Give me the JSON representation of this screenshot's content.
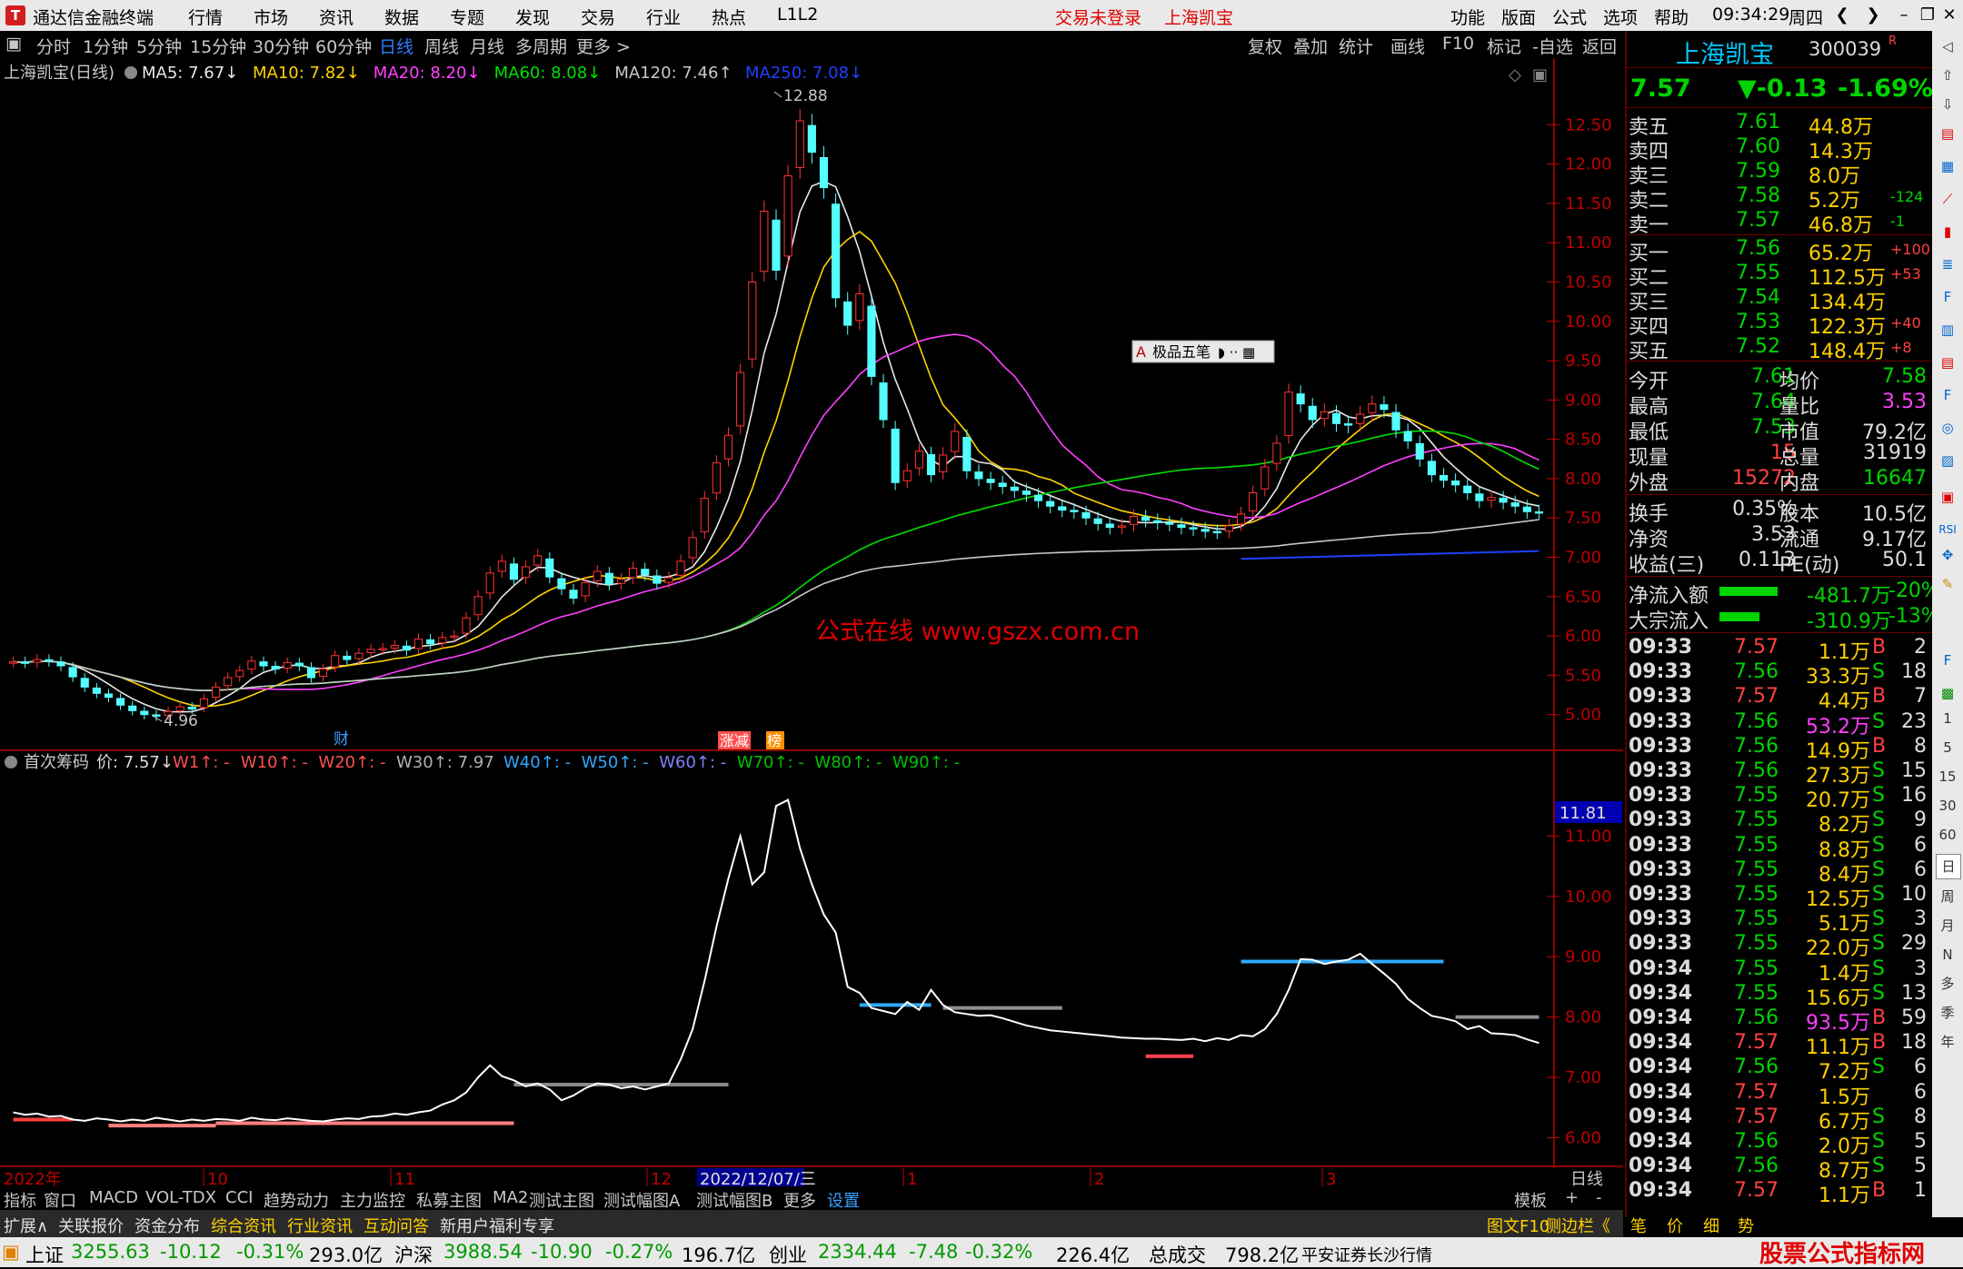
{
  "app": {
    "title": "通达信金融终端"
  },
  "menu": {
    "items": [
      "行情",
      "市场",
      "资讯",
      "数据",
      "专题",
      "发现",
      "交易",
      "行业",
      "热点",
      "L1L2"
    ],
    "trade_status": "交易未登录",
    "stock_name": "上海凯宝",
    "right_items": [
      "功能",
      "版面",
      "公式",
      "选项",
      "帮助"
    ],
    "time": "09:34:29",
    "weekday": "周四"
  },
  "periods": [
    "分时",
    "1分钟",
    "5分钟",
    "15分钟",
    "30分钟",
    "60分钟",
    "日线",
    "周线",
    "月线",
    "多周期",
    "更多 >"
  ],
  "tools": [
    "复权",
    "叠加",
    "统计",
    "画线",
    "F10",
    "标记",
    "-自选",
    "返回"
  ],
  "chart_header": {
    "title": "上海凯宝(日线)",
    "ma": [
      {
        "label": "MA5: 7.67↓",
        "color": "#e8e8e8"
      },
      {
        "label": "MA10: 7.82↓",
        "color": "#ffd400"
      },
      {
        "label": "MA20: 8.20↓",
        "color": "#ff40ff"
      },
      {
        "label": "MA60: 8.08↓",
        "color": "#00e000"
      },
      {
        "label": "MA120: 7.46↑",
        "color": "#c8c8c8"
      },
      {
        "label": "MA250: 7.08↓",
        "color": "#2040ff"
      }
    ]
  },
  "annotations": {
    "high": "12.88",
    "low": "4.96",
    "watermark": "公式在线  www.gszx.com.cn",
    "tag_cai": "财",
    "tag_zhangjian": "涨减",
    "tag_bang": "榜",
    "tool_popup": "极品五笔"
  },
  "sub_header": {
    "title": "首次筹码",
    "price": "价: 7.57↓",
    "items": [
      {
        "label": "W1↑: -",
        "color": "#ff5050"
      },
      {
        "label": "W10↑: -",
        "color": "#ff5050"
      },
      {
        "label": "W20↑: -",
        "color": "#ff5050"
      },
      {
        "label": "W30↑: 7.97",
        "color": "#b0b0b0"
      },
      {
        "label": "W40↑: -",
        "color": "#30a8ff"
      },
      {
        "label": "W50↑: -",
        "color": "#30a8ff"
      },
      {
        "label": "W60↑: -",
        "color": "#8080ff"
      },
      {
        "label": "W70↑: -",
        "color": "#00c000"
      },
      {
        "label": "W80↑: -",
        "color": "#00c000"
      },
      {
        "label": "W90↑: -",
        "color": "#00c000"
      }
    ],
    "current_marker": "11.81"
  },
  "x_axis": {
    "labels": [
      "2022年",
      "10",
      "11",
      "12",
      "2022/12/07/三",
      "1",
      "2",
      "3"
    ],
    "period": "日线"
  },
  "chart_data": {
    "type": "candlestick",
    "symbol": "300039",
    "ylim": [
      4.8,
      13.0
    ],
    "yticks": [
      5.0,
      5.5,
      6.0,
      6.5,
      7.0,
      7.5,
      8.0,
      8.5,
      9.0,
      9.5,
      10.0,
      10.5,
      11.0,
      11.5,
      12.0,
      12.5
    ],
    "closes": [
      5.67,
      5.66,
      5.7,
      5.68,
      5.62,
      5.48,
      5.35,
      5.27,
      5.22,
      5.12,
      5.05,
      5.0,
      4.98,
      5.04,
      5.1,
      5.07,
      5.2,
      5.35,
      5.47,
      5.56,
      5.68,
      5.62,
      5.58,
      5.66,
      5.62,
      5.47,
      5.58,
      5.75,
      5.7,
      5.78,
      5.83,
      5.84,
      5.88,
      5.82,
      5.96,
      5.9,
      5.98,
      6.0,
      6.23,
      6.5,
      6.8,
      6.95,
      6.72,
      6.88,
      7.02,
      6.75,
      6.6,
      6.48,
      6.68,
      6.82,
      6.66,
      6.72,
      6.86,
      6.78,
      6.67,
      6.74,
      6.95,
      7.25,
      7.75,
      8.2,
      8.55,
      9.35,
      10.5,
      11.4,
      10.65,
      11.85,
      12.55,
      12.15,
      11.7,
      10.3,
      9.95,
      10.35,
      9.3,
      8.75,
      7.95,
      8.1,
      8.35,
      8.05,
      8.3,
      8.6,
      8.1,
      8.0,
      7.95,
      7.9,
      7.85,
      7.8,
      7.72,
      7.65,
      7.6,
      7.58,
      7.5,
      7.43,
      7.38,
      7.4,
      7.52,
      7.47,
      7.44,
      7.42,
      7.38,
      7.36,
      7.33,
      7.32,
      7.4,
      7.55,
      7.82,
      8.15,
      8.45,
      9.1,
      8.95,
      8.75,
      8.85,
      8.7,
      8.68,
      8.82,
      8.95,
      8.88,
      8.62,
      8.48,
      8.25,
      8.05,
      7.98,
      7.92,
      7.82,
      7.72,
      7.76,
      7.7,
      7.65,
      7.58,
      7.57
    ],
    "ma5": 7.67,
    "ma10": 7.82,
    "ma20": 8.2,
    "ma60": 8.08,
    "ma120": 7.46,
    "ma250": 7.08,
    "chip_line": [
      6.42,
      6.38,
      6.4,
      6.35,
      6.36,
      6.3,
      6.28,
      6.32,
      6.3,
      6.27,
      6.3,
      6.28,
      6.33,
      6.3,
      6.27,
      6.3,
      6.28,
      6.31,
      6.3,
      6.28,
      6.33,
      6.3,
      6.29,
      6.32,
      6.3,
      6.28,
      6.27,
      6.3,
      6.32,
      6.31,
      6.35,
      6.36,
      6.4,
      6.38,
      6.42,
      6.45,
      6.55,
      6.62,
      6.75,
      7.0,
      7.2,
      7.02,
      6.95,
      6.85,
      6.9,
      6.8,
      6.62,
      6.7,
      6.82,
      6.9,
      6.88,
      6.82,
      6.85,
      6.8,
      6.85,
      6.9,
      7.3,
      7.8,
      8.6,
      9.5,
      10.3,
      11.0,
      10.2,
      10.4,
      11.5,
      11.6,
      10.8,
      10.2,
      9.7,
      9.4,
      8.5,
      8.4,
      8.15,
      8.1,
      8.05,
      8.25,
      8.12,
      8.45,
      8.2,
      8.08,
      8.05,
      8.02,
      8.03,
      7.98,
      7.92,
      7.86,
      7.82,
      7.78,
      7.76,
      7.74,
      7.72,
      7.7,
      7.68,
      7.66,
      7.65,
      7.64,
      7.64,
      7.63,
      7.62,
      7.64,
      7.6,
      7.65,
      7.62,
      7.7,
      7.68,
      7.8,
      8.05,
      8.45,
      8.96,
      8.95,
      8.88,
      8.92,
      8.95,
      9.05,
      8.88,
      8.72,
      8.55,
      8.3,
      8.15,
      8.02,
      7.98,
      7.93,
      7.8,
      7.85,
      7.73,
      7.72,
      7.7,
      7.63,
      7.57
    ],
    "sub_ylim": [
      5.6,
      12.0
    ],
    "sub_yticks": [
      6.0,
      7.0,
      8.0,
      9.0,
      10.0,
      11.0
    ],
    "chip_levels": [
      {
        "name": "W1",
        "from": 0,
        "to": 5,
        "value": 6.3,
        "color": "#ff4040"
      },
      {
        "name": "W10",
        "from": 8,
        "to": 17,
        "value": 6.2,
        "color": "#ff8080"
      },
      {
        "name": "W20",
        "from": 17,
        "to": 42,
        "value": 6.24,
        "color": "#ff8080"
      },
      {
        "name": "W30",
        "from": 42,
        "to": 60,
        "value": 6.88,
        "color": "#888888"
      },
      {
        "name": "W40",
        "from": 71,
        "to": 77,
        "value": 8.2,
        "color": "#30a8ff"
      },
      {
        "name": "W30",
        "from": 78,
        "to": 88,
        "value": 8.15,
        "color": "#909090"
      },
      {
        "name": "W20",
        "from": 95,
        "to": 99,
        "value": 7.35,
        "color": "#ff4050"
      },
      {
        "name": "W40",
        "from": 103,
        "to": 120,
        "value": 8.92,
        "color": "#30a8ff"
      },
      {
        "name": "W30",
        "from": 121,
        "to": 128,
        "value": 8.0,
        "color": "#909090"
      }
    ]
  },
  "quote": {
    "name": "上海凯宝",
    "code": "300039",
    "price": "7.57",
    "change": "▼-0.13",
    "pct": "-1.69%",
    "asks": [
      {
        "label": "卖五",
        "p": "7.61",
        "v": "44.8万",
        "d": ""
      },
      {
        "label": "卖四",
        "p": "7.60",
        "v": "14.3万",
        "d": ""
      },
      {
        "label": "卖三",
        "p": "7.59",
        "v": "8.0万",
        "d": ""
      },
      {
        "label": "卖二",
        "p": "7.58",
        "v": "5.2万",
        "d": "-124"
      },
      {
        "label": "卖一",
        "p": "7.57",
        "v": "46.8万",
        "d": "-1"
      }
    ],
    "bids": [
      {
        "label": "买一",
        "p": "7.56",
        "v": "65.2万",
        "d": "+100"
      },
      {
        "label": "买二",
        "p": "7.55",
        "v": "112.5万",
        "d": "+53"
      },
      {
        "label": "买三",
        "p": "7.54",
        "v": "134.4万",
        "d": ""
      },
      {
        "label": "买四",
        "p": "7.53",
        "v": "122.3万",
        "d": "+40"
      },
      {
        "label": "买五",
        "p": "7.52",
        "v": "148.4万",
        "d": "+8"
      }
    ],
    "stats": [
      {
        "l1": "今开",
        "v1": "7.61",
        "l2": "均价",
        "v2": "7.58"
      },
      {
        "l1": "最高",
        "v1": "7.64",
        "l2": "量比",
        "v2": "3.53"
      },
      {
        "l1": "最低",
        "v1": "7.53",
        "l2": "市值",
        "v2": "79.2亿"
      },
      {
        "l1": "现量",
        "v1": "15",
        "l2": "总量",
        "v2": "31919"
      },
      {
        "l1": "外盘",
        "v1": "15272",
        "l2": "内盘",
        "v2": "16647"
      }
    ],
    "stats2": [
      {
        "l1": "换手",
        "v1": "0.35%",
        "l2": "股本",
        "v2": "10.5亿"
      },
      {
        "l1": "净资",
        "v1": "3.53",
        "l2": "流通",
        "v2": "9.17亿"
      },
      {
        "l1": "收益(三)",
        "v1": "0.113",
        "l2": "PE(动)",
        "v2": "50.1"
      }
    ],
    "flows": [
      {
        "label": "净流入额",
        "v": "-481.7万",
        "pct": "-20%"
      },
      {
        "label": "大宗流入",
        "v": "-310.9万",
        "pct": "-13%"
      }
    ],
    "ticks": [
      {
        "t": "09:33",
        "p": "7.57",
        "v": "1.1万",
        "s": "B",
        "n": "2"
      },
      {
        "t": "09:33",
        "p": "7.56",
        "v": "33.3万",
        "s": "S",
        "n": "18"
      },
      {
        "t": "09:33",
        "p": "7.57",
        "v": "4.4万",
        "s": "B",
        "n": "7"
      },
      {
        "t": "09:33",
        "p": "7.56",
        "v": "53.2万",
        "s": "S",
        "n": "23"
      },
      {
        "t": "09:33",
        "p": "7.56",
        "v": "14.9万",
        "s": "B",
        "n": "8"
      },
      {
        "t": "09:33",
        "p": "7.56",
        "v": "27.3万",
        "s": "S",
        "n": "15"
      },
      {
        "t": "09:33",
        "p": "7.55",
        "v": "20.7万",
        "s": "S",
        "n": "16"
      },
      {
        "t": "09:33",
        "p": "7.55",
        "v": "8.2万",
        "s": "S",
        "n": "9"
      },
      {
        "t": "09:33",
        "p": "7.55",
        "v": "8.8万",
        "s": "S",
        "n": "6"
      },
      {
        "t": "09:33",
        "p": "7.55",
        "v": "8.4万",
        "s": "S",
        "n": "6"
      },
      {
        "t": "09:33",
        "p": "7.55",
        "v": "12.5万",
        "s": "S",
        "n": "10"
      },
      {
        "t": "09:33",
        "p": "7.55",
        "v": "5.1万",
        "s": "S",
        "n": "3"
      },
      {
        "t": "09:33",
        "p": "7.55",
        "v": "22.0万",
        "s": "S",
        "n": "29"
      },
      {
        "t": "09:34",
        "p": "7.55",
        "v": "1.4万",
        "s": "S",
        "n": "3"
      },
      {
        "t": "09:34",
        "p": "7.55",
        "v": "15.6万",
        "s": "S",
        "n": "13"
      },
      {
        "t": "09:34",
        "p": "7.56",
        "v": "93.5万",
        "s": "B",
        "n": "59"
      },
      {
        "t": "09:34",
        "p": "7.57",
        "v": "11.1万",
        "s": "B",
        "n": "18"
      },
      {
        "t": "09:34",
        "p": "7.56",
        "v": "7.2万",
        "s": "S",
        "n": "6"
      },
      {
        "t": "09:34",
        "p": "7.57",
        "v": "1.5万",
        "s": "",
        "n": "6"
      },
      {
        "t": "09:34",
        "p": "7.57",
        "v": "6.7万",
        "s": "S",
        "n": "8"
      },
      {
        "t": "09:34",
        "p": "7.56",
        "v": "2.0万",
        "s": "S",
        "n": "5"
      },
      {
        "t": "09:34",
        "p": "7.56",
        "v": "8.7万",
        "s": "S",
        "n": "5"
      },
      {
        "t": "09:34",
        "p": "7.57",
        "v": "1.1万",
        "s": "B",
        "n": "1"
      }
    ]
  },
  "bottom_tabs1": [
    "指标",
    "窗口",
    "MACD",
    "VOL-TDX",
    "CCI",
    "趋势动力",
    "主力监控",
    "私募主图",
    "MA2",
    "测试主图",
    "测试幅图A",
    "测试幅图B",
    "更多",
    "设置",
    "模板",
    "+",
    "-"
  ],
  "bottom_tabs2": [
    "扩展∧",
    "关联报价",
    "资金分布",
    "综合资讯",
    "行业资讯",
    "互动问答",
    "新用户福利专享",
    "图文F10",
    "侧边栏《",
    "笔",
    "价",
    "细",
    "势"
  ],
  "status": [
    {
      "name": "上证",
      "v": "3255.63",
      "c": "-10.12",
      "p": "-0.31%",
      "a": "293.0亿"
    },
    {
      "name": "沪深",
      "v": "3988.54",
      "c": "-10.90",
      "p": "-0.27%",
      "a": "196.7亿"
    },
    {
      "name": "创业",
      "v": "2334.44",
      "c": "-7.48",
      "p": "-0.32%",
      "a": "226.4亿"
    }
  ],
  "status_total": {
    "label": "总成交",
    "v": "798.2亿"
  },
  "status_broker": "平安证券长沙行情",
  "corner_watermark": {
    "cn": "股票公式指标网",
    "url": "www.gszx.com.cn"
  },
  "side_icons": [
    "日",
    "周",
    "月",
    "N",
    "多",
    "季",
    "年"
  ],
  "side_minutes": [
    "1",
    "5",
    "15",
    "30",
    "60"
  ]
}
